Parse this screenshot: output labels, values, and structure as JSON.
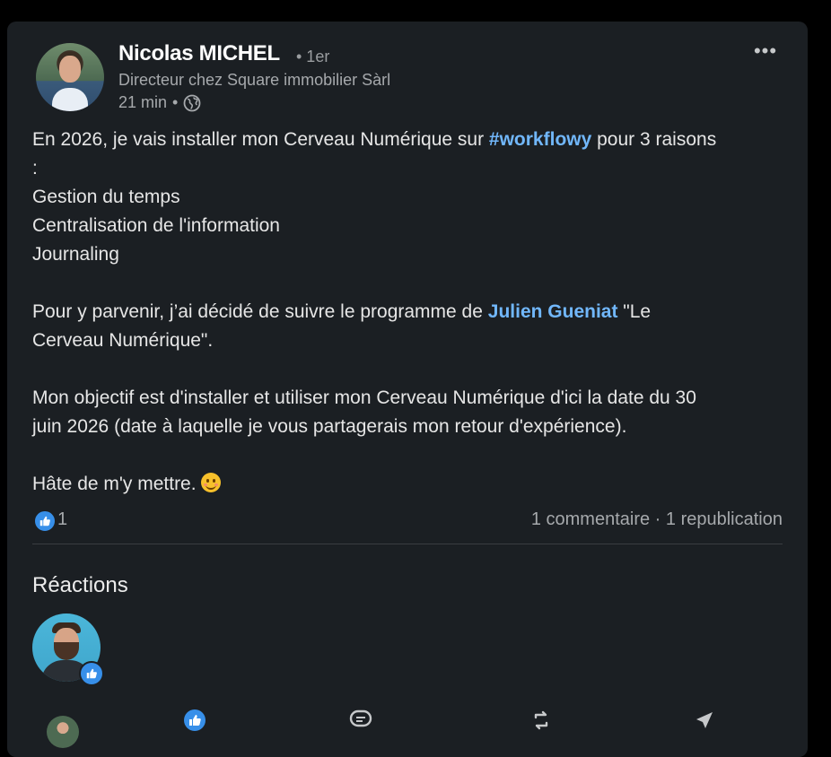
{
  "author": {
    "name": "Nicolas MICHEL",
    "degree": "• 1er",
    "title": "Directeur chez Square immobilier Sàrl",
    "time": "21 min",
    "separator": "•",
    "visibility_icon": "globe-icon"
  },
  "post": {
    "line1_pre": "En 2026, je vais installer mon Cerveau Numérique sur ",
    "hashtag": "#workflowy",
    "line1_post": " pour 3 raisons",
    "line2": ":",
    "line3": "Gestion du temps",
    "line4": "Centralisation de l'information",
    "line5": "Journaling",
    "para2_pre": "Pour y parvenir, j’ai décidé de suivre le programme de ",
    "mention": "Julien Gueniat",
    "para2_post": " \"Le",
    "para2_line2": "Cerveau Numérique\".",
    "para3_line1": "Mon objectif est d'installer et utiliser mon Cerveau Numérique d'ici la date du 30",
    "para3_line2": "juin 2026 (date à laquelle je vous partagerais mon retour d'expérience).",
    "closing": "Hâte de m'y mettre. ",
    "closing_emoji": "smiling-face-emoji"
  },
  "stats": {
    "like_count": "1",
    "comments": "1 commentaire",
    "dot": " · ",
    "reposts": "1 republication"
  },
  "reactions": {
    "title": "Réactions"
  },
  "actions": [
    "like-icon",
    "comment-icon",
    "repost-icon",
    "send-icon"
  ],
  "colors": {
    "card_bg": "#1b1f23",
    "link": "#71b7fb",
    "like_blue": "#378fe9"
  }
}
